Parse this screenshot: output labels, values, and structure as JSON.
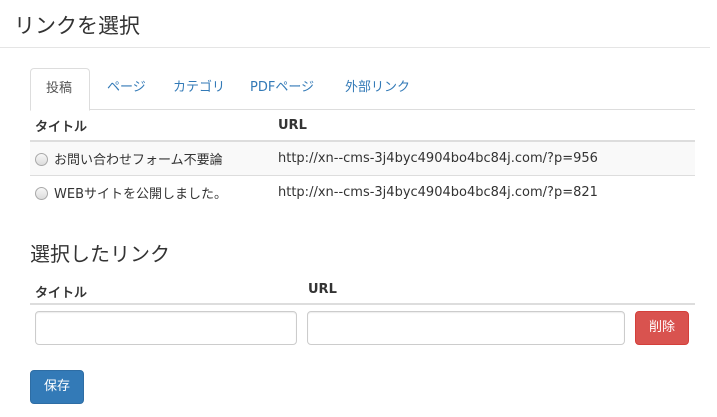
{
  "title": "リンクを選択",
  "tabs": [
    {
      "label": "投稿",
      "active": true
    },
    {
      "label": "ページ",
      "active": false
    },
    {
      "label": "カテゴリ",
      "active": false
    },
    {
      "label": "PDFページ",
      "active": false
    },
    {
      "label": "外部リンク",
      "active": false
    }
  ],
  "link_table": {
    "headers": {
      "title": "タイトル",
      "url": "URL"
    },
    "rows": [
      {
        "title": "お問い合わせフォーム不要論",
        "url": "http://xn--cms-3j4byc4904bo4bc84j.com/?p=956"
      },
      {
        "title": "WEBサイトを公開しました。",
        "url": "http://xn--cms-3j4byc4904bo4bc84j.com/?p=821"
      }
    ]
  },
  "selected": {
    "heading": "選択したリンク",
    "headers": {
      "title": "タイトル",
      "url": "URL"
    },
    "title_value": "",
    "url_value": "",
    "delete_label": "削除"
  },
  "save_label": "保存",
  "colors": {
    "link": "#337ab7",
    "danger": "#d9534f",
    "primary": "#337ab7"
  }
}
